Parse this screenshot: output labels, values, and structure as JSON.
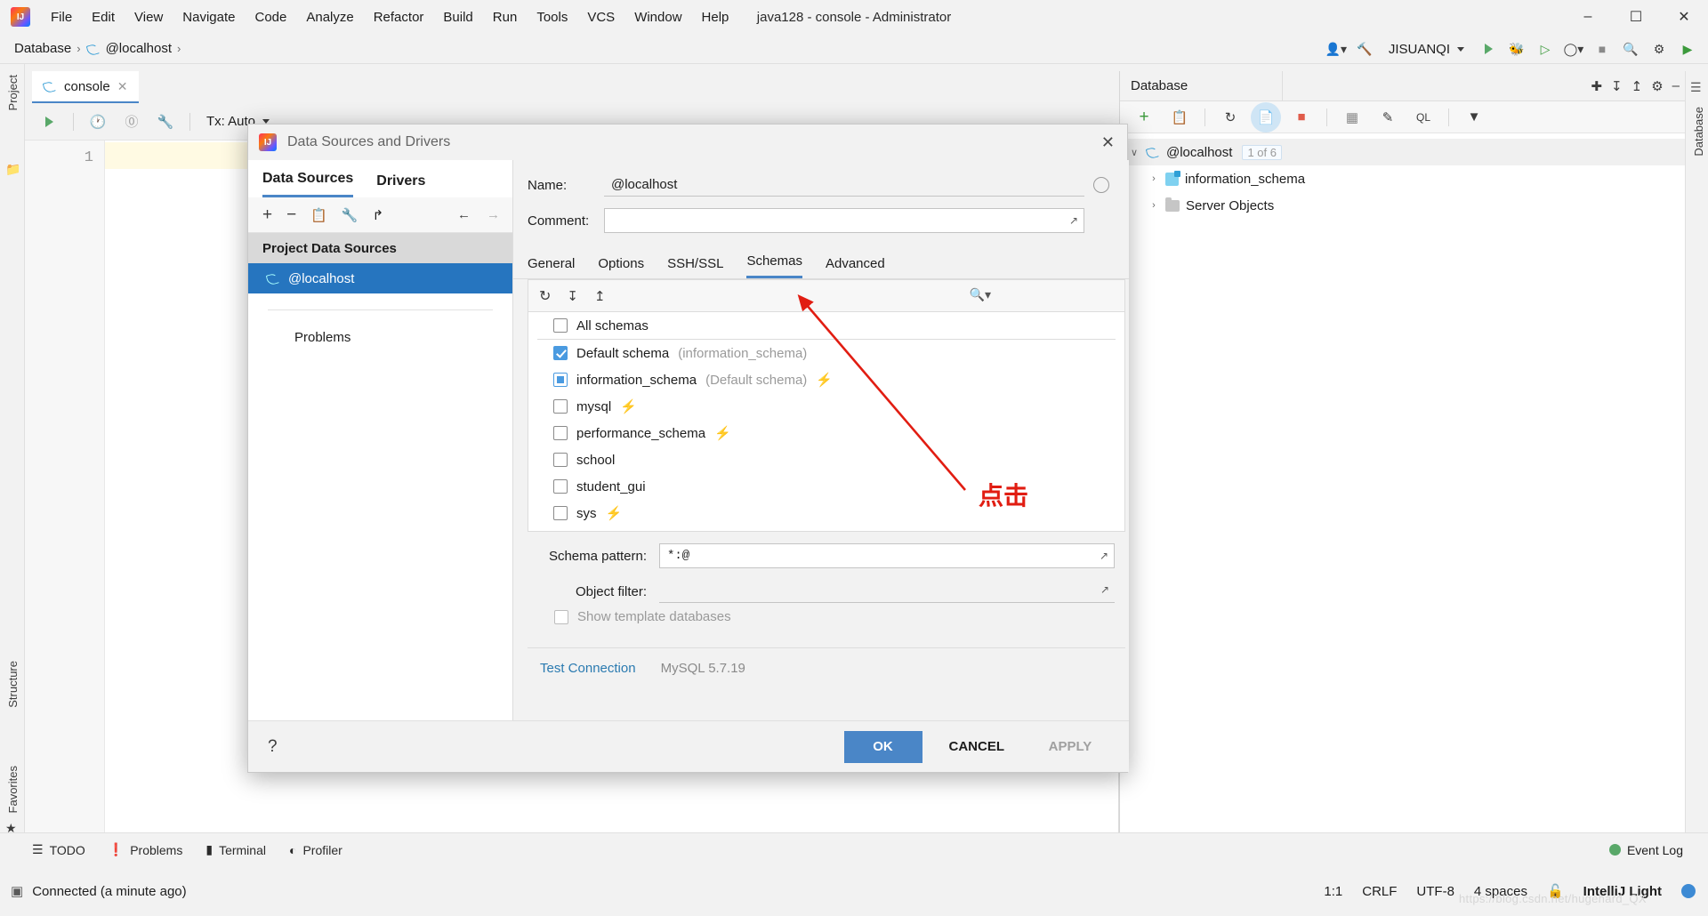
{
  "window": {
    "title": "java128 - console - Administrator",
    "menu": [
      "File",
      "Edit",
      "View",
      "Navigate",
      "Code",
      "Analyze",
      "Refactor",
      "Build",
      "Run",
      "Tools",
      "VCS",
      "Window",
      "Help"
    ],
    "controls": {
      "minimize": "–",
      "maximize": "☐",
      "close": "✕"
    }
  },
  "navbar": {
    "breadcrumb": [
      "Database",
      "@localhost"
    ],
    "separator": "›",
    "run_config": "JISUANQI"
  },
  "left_strip": {
    "project": "Project",
    "structure": "Structure",
    "favorites": "Favorites"
  },
  "editor": {
    "tab_label": "console",
    "tab_close": "✕",
    "tx_label": "Tx: Auto",
    "line_number": "1"
  },
  "database_panel": {
    "title": "Database",
    "vertical_label": "Database",
    "tree": [
      {
        "label": "@localhost",
        "badge": "1 of 6",
        "chevron": "∨",
        "icon": "datasource-icon"
      },
      {
        "label": "information_schema",
        "badge": "",
        "chevron": "›",
        "icon": "schema-icon"
      },
      {
        "label": "Server Objects",
        "badge": "",
        "chevron": "›",
        "icon": "folder-icon"
      }
    ]
  },
  "dialog": {
    "title": "Data Sources and Drivers",
    "close": "✕",
    "tabs": [
      {
        "label": "Data Sources",
        "active": true
      },
      {
        "label": "Drivers",
        "active": false
      }
    ],
    "left_toolbar": {
      "add": "+",
      "remove": "−",
      "copy": "copy-icon",
      "wrench": "wrench-icon",
      "import": "import-icon",
      "back": "←",
      "forward": "→"
    },
    "group_header": "Project Data Sources",
    "selected_source": "@localhost",
    "problems_label": "Problems",
    "name_label": "Name:",
    "name_value": "@localhost",
    "comment_label": "Comment:",
    "comment_value": "",
    "subtabs": [
      {
        "label": "General",
        "active": false
      },
      {
        "label": "Options",
        "active": false
      },
      {
        "label": "SSH/SSL",
        "active": false
      },
      {
        "label": "Schemas",
        "active": true
      },
      {
        "label": "Advanced",
        "active": false
      }
    ],
    "schema_toolbar": {
      "refresh": "refresh-icon",
      "expand_all": "expand-all-icon",
      "collapse_all": "collapse-all-icon",
      "search": "search-icon"
    },
    "schemas": [
      {
        "label": "All schemas",
        "note": "",
        "state": "unchecked",
        "bolt": false
      },
      {
        "label": "Default schema",
        "note": "(information_schema)",
        "state": "checked",
        "bolt": false
      },
      {
        "label": "information_schema",
        "note": "(Default schema)",
        "state": "partial",
        "bolt": true
      },
      {
        "label": "mysql",
        "note": "",
        "state": "unchecked",
        "bolt": true
      },
      {
        "label": "performance_schema",
        "note": "",
        "state": "unchecked",
        "bolt": true
      },
      {
        "label": "school",
        "note": "",
        "state": "unchecked",
        "bolt": false
      },
      {
        "label": "student_gui",
        "note": "",
        "state": "unchecked",
        "bolt": false
      },
      {
        "label": "sys",
        "note": "",
        "state": "unchecked",
        "bolt": true
      }
    ],
    "schema_pattern_label": "Schema pattern:",
    "schema_pattern_value": "*:@",
    "object_filter_label": "Object filter:",
    "object_filter_value": "",
    "show_template_label": "Show template databases",
    "test_connection": "Test Connection",
    "driver_version": "MySQL 5.7.19",
    "help": "?",
    "buttons": {
      "ok": "OK",
      "cancel": "CANCEL",
      "apply": "APPLY"
    }
  },
  "annotation": {
    "text": "点击",
    "color": "#e11d12"
  },
  "bottom_bar": {
    "items": [
      {
        "label": "TODO",
        "icon": "list-icon"
      },
      {
        "label": "Problems",
        "icon": "warning-icon"
      },
      {
        "label": "Terminal",
        "icon": "terminal-icon"
      },
      {
        "label": "Profiler",
        "icon": "profiler-icon"
      }
    ],
    "event_log": "Event Log"
  },
  "status_bar": {
    "message": "Connected (a minute ago)",
    "caret": "1:1",
    "line_sep": "CRLF",
    "encoding": "UTF-8",
    "indent": "4 spaces",
    "theme": "IntelliJ Light"
  },
  "watermark": "https://blog.csdn.net/hugehard_QX"
}
